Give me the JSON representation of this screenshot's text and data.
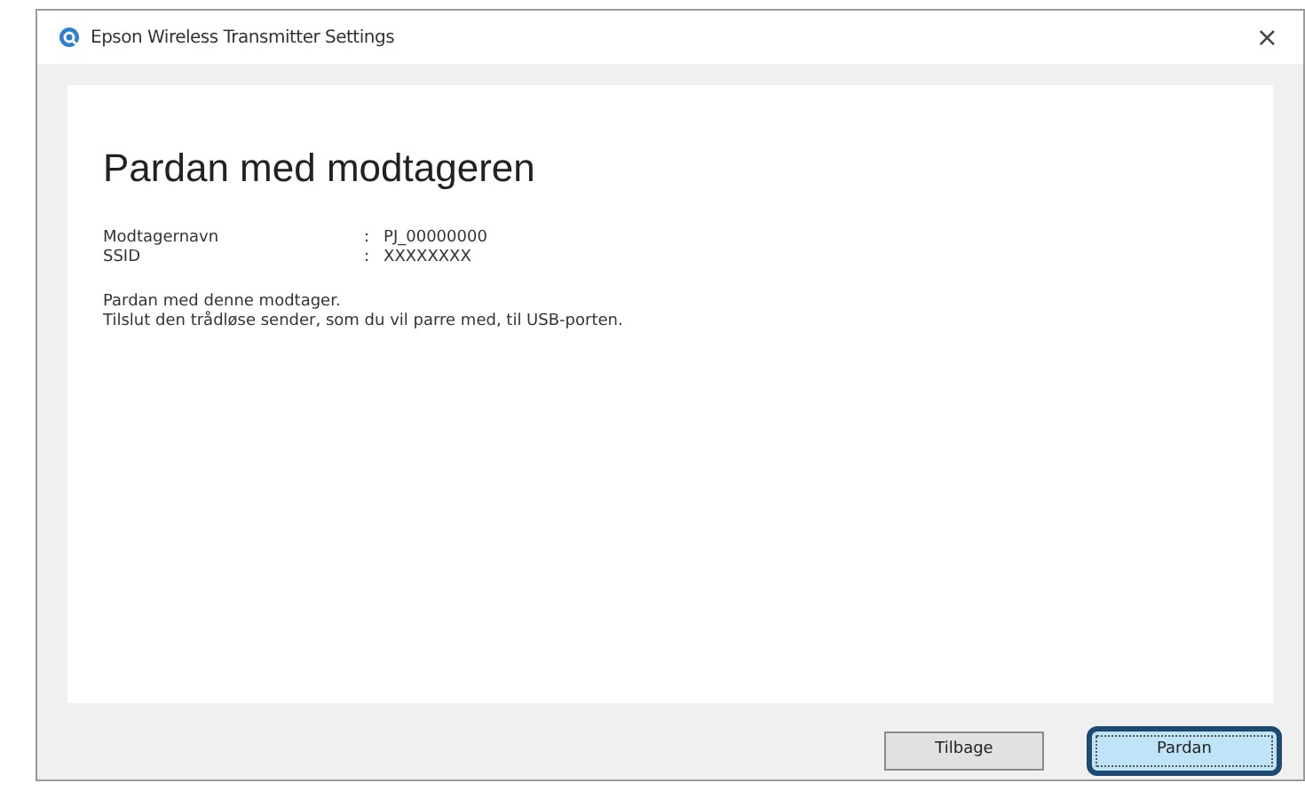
{
  "window": {
    "title": "Epson Wireless Transmitter Settings",
    "close": "×"
  },
  "heading": "Pardan med modtageren",
  "info": [
    {
      "label": "Modtagernavn",
      "separator": ":",
      "value": "PJ_00000000"
    },
    {
      "label": "SSID",
      "separator": ":",
      "value": "XXXXXXXX"
    }
  ],
  "message": [
    "Pardan med denne modtager.",
    "Tilslut den trådløse sender, som du vil parre med, til USB-porten."
  ],
  "buttons": [
    {
      "label": "Tilbage",
      "highlighted": false
    },
    {
      "label": "Pardan",
      "highlighted": true
    }
  ]
}
